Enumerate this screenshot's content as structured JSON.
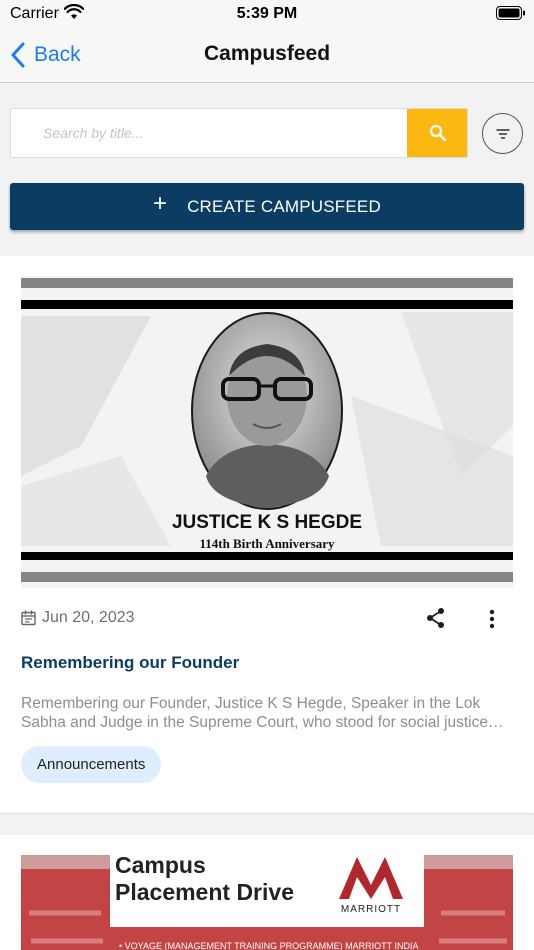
{
  "status_bar": {
    "carrier": "Carrier",
    "time": "5:39 PM"
  },
  "nav": {
    "back_label": "Back",
    "title": "Campusfeed"
  },
  "search": {
    "placeholder": "Search by title..."
  },
  "create_button": {
    "label": "CREATE CAMPUSFEED"
  },
  "colors": {
    "accent": "#fcb810",
    "primary": "#0b3d63",
    "link": "#1a7cf0",
    "chip_bg": "#dfeefe"
  },
  "feed": [
    {
      "image": {
        "headline": "JUSTICE K S HEGDE",
        "subheadline": "114th Birth Anniversary"
      },
      "date": "Jun 20, 2023",
      "title": "Remembering our Founder",
      "excerpt": "Remembering our Founder, Justice K S Hegde, Speaker in the Lok Sabha and Judge in the Supreme Court, who stood for social justice and firmly upheld the values of the Constitution.",
      "tag": "Announcements"
    },
    {
      "image": {
        "headline_line1": "Campus",
        "headline_line2": "Placement Drive",
        "brand": "MARRIOTT",
        "banner": "• VOYAGE (MANAGEMENT TRAINING PROGRAMME) MARRIOTT INDIA"
      }
    }
  ]
}
